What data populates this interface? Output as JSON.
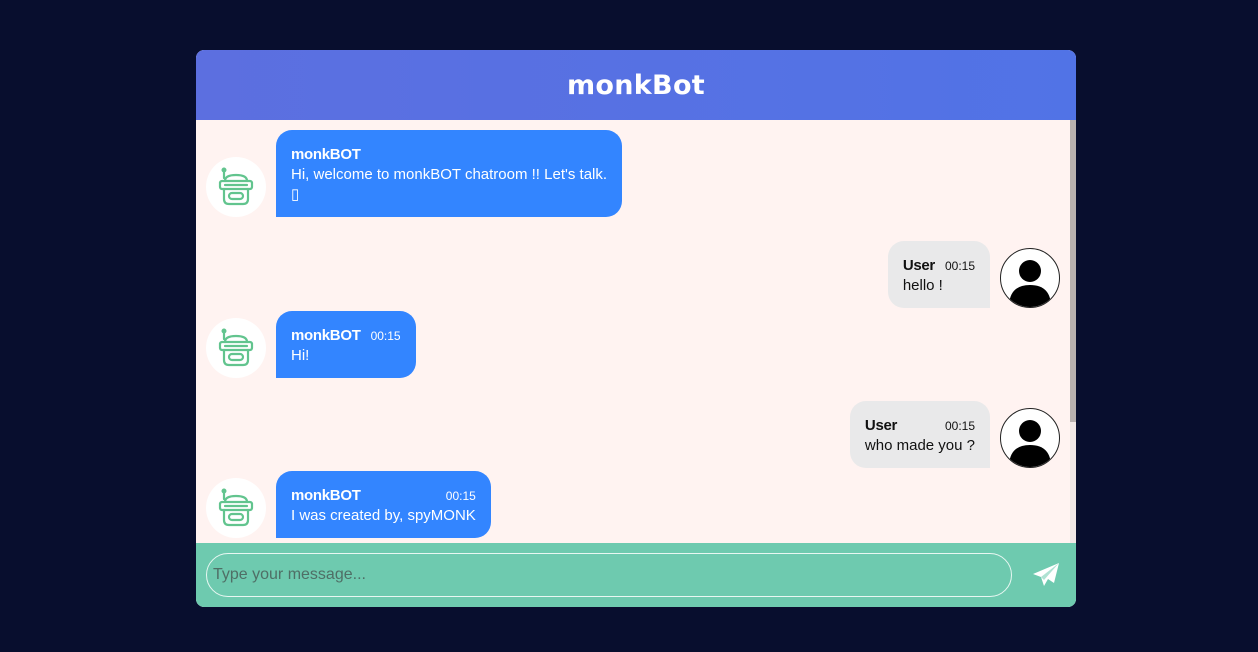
{
  "header": {
    "title": "monkBot"
  },
  "messages": [
    {
      "from": "bot",
      "sender": "monkBOT",
      "time": "",
      "text": "Hi, welcome to monkBOT chatroom !! Let's talk.\n▯"
    },
    {
      "from": "user",
      "sender": "User",
      "time": "00:15",
      "text": "hello !"
    },
    {
      "from": "bot",
      "sender": "monkBOT",
      "time": "00:15",
      "text": "Hi!"
    },
    {
      "from": "user",
      "sender": "User",
      "time": "00:15",
      "text": "who made you ?"
    },
    {
      "from": "bot",
      "sender": "monkBOT",
      "time": "00:15",
      "text": "I was created by, spyMONK"
    }
  ],
  "input": {
    "placeholder": "Type your message..."
  },
  "icons": {
    "bot_avatar": "robot-icon",
    "user_avatar": "user-silhouette-icon",
    "send": "paper-plane-icon"
  },
  "colors": {
    "header": "#5470e4",
    "bot_bubble": "#3385ff",
    "user_bubble": "#e9e9ea",
    "input_bar": "#6ecaaf",
    "background": "#080e2e"
  }
}
